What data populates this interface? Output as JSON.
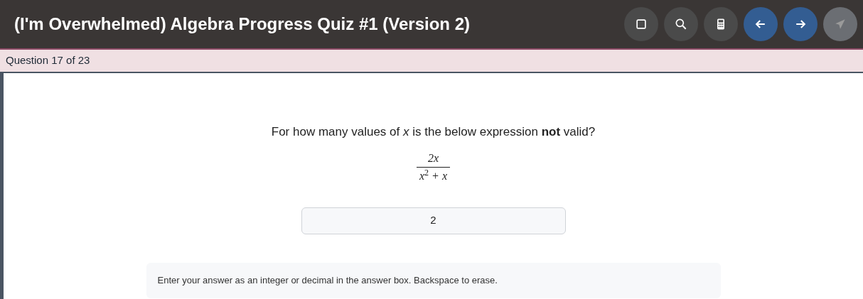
{
  "header": {
    "title": "(I'm Overwhelmed) Algebra Progress Quiz #1 (Version 2)",
    "buttons": [
      {
        "kind": "square",
        "disabled": false
      },
      {
        "kind": "search",
        "disabled": false
      },
      {
        "kind": "calculator",
        "disabled": false
      },
      {
        "kind": "back",
        "disabled": false
      },
      {
        "kind": "forward",
        "disabled": false
      },
      {
        "kind": "send",
        "disabled": true
      }
    ]
  },
  "progress": "Question 17 of 23",
  "question": {
    "prompt": "For how many values of *x* is the below expression **not** valid?",
    "numerator": "2x",
    "denominator": "x$^{2}$ + x"
  },
  "answer": {
    "value": "2"
  },
  "hint": "Enter your answer as an integer or decimal in the answer box. Backspace to erase."
}
